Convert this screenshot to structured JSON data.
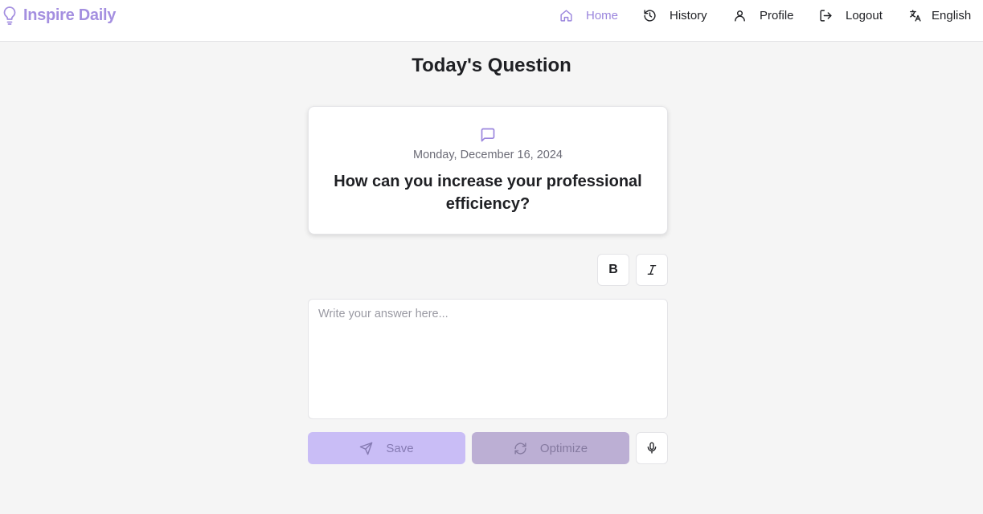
{
  "header": {
    "brand": "Inspire Daily",
    "nav": [
      {
        "label": "Home",
        "icon": "home-icon",
        "active": true
      },
      {
        "label": "History",
        "icon": "history-icon"
      },
      {
        "label": "Profile",
        "icon": "user-icon"
      },
      {
        "label": "Logout",
        "icon": "logout-icon"
      },
      {
        "label": "English",
        "icon": "language-icon"
      }
    ]
  },
  "main": {
    "title": "Today's Question",
    "card": {
      "icon": "chat-icon",
      "date": "Monday, December 16, 2024",
      "question": "How can you increase your professional efficiency?"
    },
    "toolbar": {
      "bold_label": "B",
      "italic_icon": "italic-icon"
    },
    "answer": {
      "placeholder": "Write your answer here...",
      "value": ""
    },
    "actions": {
      "save_label": "Save",
      "optimize_label": "Optimize",
      "mic_icon": "microphone-icon"
    }
  },
  "colors": {
    "accent": "#9a85dd",
    "save_bg": "#c9bdf6",
    "optimize_bg": "#bcafd4",
    "background": "#f5f5f5"
  }
}
